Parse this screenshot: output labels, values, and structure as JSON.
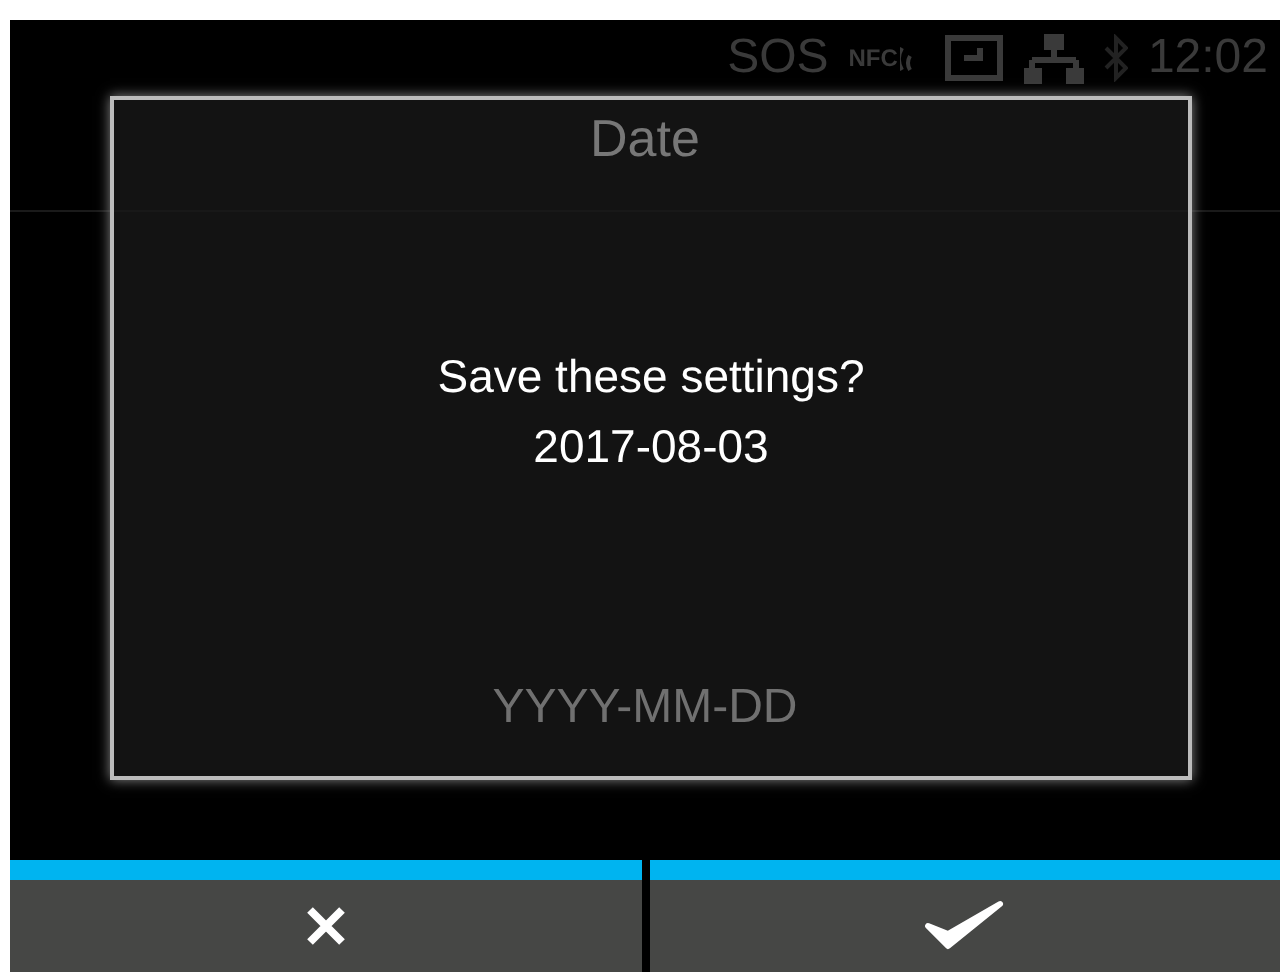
{
  "status_bar": {
    "sos": "SOS",
    "nfc": "NFC",
    "time": "12:02"
  },
  "screen": {
    "title": "Date",
    "format_hint": "YYYY-MM-DD"
  },
  "dialog": {
    "message": "Save these settings?",
    "value": "2017-08-03"
  },
  "buttons": [
    {
      "kind": "cancel"
    },
    {
      "kind": "confirm"
    }
  ]
}
